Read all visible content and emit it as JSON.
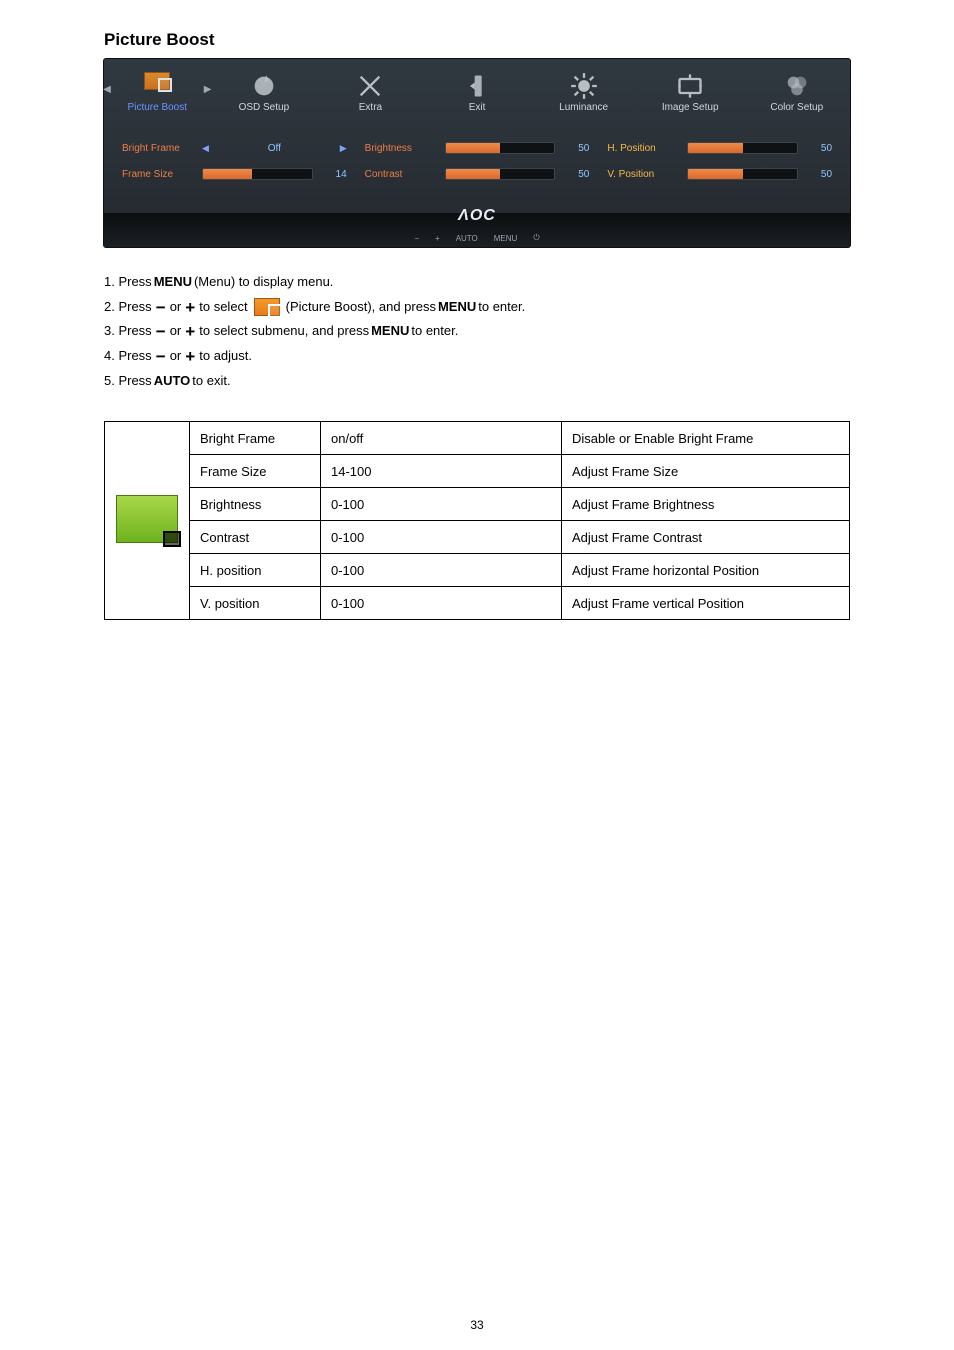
{
  "section_heading": "Picture Boost",
  "osd": {
    "tabs": [
      {
        "id": "picture-boost",
        "label": "Picture Boost",
        "selected": true
      },
      {
        "id": "osd-setup",
        "label": "OSD Setup"
      },
      {
        "id": "extra",
        "label": "Extra"
      },
      {
        "id": "exit",
        "label": "Exit"
      },
      {
        "id": "luminance",
        "label": "Luminance"
      },
      {
        "id": "image-setup",
        "label": "Image Setup"
      },
      {
        "id": "color-setup",
        "label": "Color Setup"
      }
    ],
    "col1": {
      "bright_frame_label": "Bright Frame",
      "bright_frame_value": "Off",
      "frame_size_label": "Frame Size",
      "frame_size_value": "14",
      "frame_size_pct": 45
    },
    "col2": {
      "brightness_label": "Brightness",
      "brightness_value": "50",
      "brightness_pct": 50,
      "contrast_label": "Contrast",
      "contrast_value": "50",
      "contrast_pct": 50
    },
    "col3": {
      "hpos_label": "H. Position",
      "hpos_value": "50",
      "hpos_pct": 50,
      "vpos_label": "V. Position",
      "vpos_value": "50",
      "vpos_pct": 50
    },
    "footer": {
      "logo": "ΛOC",
      "minus": "−",
      "plus": "+",
      "auto": "AUTO",
      "menu": "MENU",
      "power": "⏻"
    }
  },
  "instructions": {
    "s1_a": "1. Press ",
    "s1_b": " (Menu) to display menu.",
    "s2_a": "2. Press ",
    "s2_or": " or ",
    "s2_b": " to select ",
    "s2_c": " (Picture Boost), and press ",
    "s2_d": " to enter.",
    "s3_a": "3. Press ",
    "s3_or": " or ",
    "s3_b": " to select submenu, and press ",
    "s3_c": " to enter.",
    "s4_a": "4. Press ",
    "s4_or": " or ",
    "s4_b": " to adjust.",
    "s5_a": "5. Press ",
    "s5_b": " to exit.",
    "menu": "MENU",
    "auto": "AUTO",
    "minus": "−",
    "plus": "+"
  },
  "table": {
    "r1": {
      "c2": "Bright Frame",
      "c3": "on/off",
      "c4": "Disable or Enable Bright Frame"
    },
    "r2": {
      "c2": "Frame Size",
      "c3": "14-100",
      "c4": "Adjust Frame Size"
    },
    "r3": {
      "c2": "Brightness",
      "c3": "0-100",
      "c4": "Adjust Frame Brightness"
    },
    "r4": {
      "c2": "Contrast",
      "c3": "0-100",
      "c4": "Adjust Frame Contrast"
    },
    "r5": {
      "c2": "H. position",
      "c3": "0-100",
      "c4": "Adjust Frame horizontal Position"
    },
    "r6": {
      "c2": "V. position",
      "c3": "0-100",
      "c4": "Adjust Frame vertical Position"
    }
  },
  "page_number": "33"
}
